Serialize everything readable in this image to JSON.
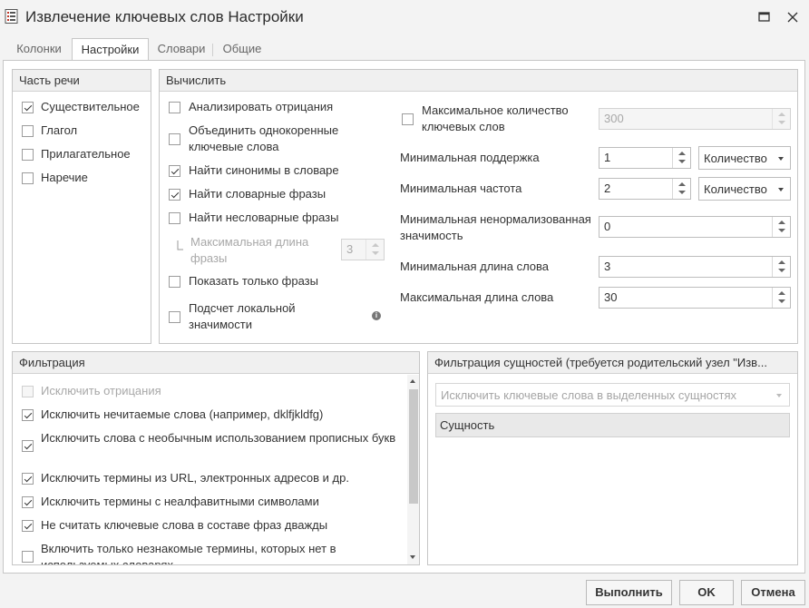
{
  "window": {
    "title": "Извлечение ключевых слов Настройки",
    "icons": [
      "app-settings-icon",
      "maximize-icon",
      "close-icon"
    ]
  },
  "tabs": [
    {
      "label": "Колонки",
      "active": false
    },
    {
      "label": "Настройки",
      "active": true
    },
    {
      "label": "Словари",
      "active": false
    },
    {
      "label": "Общие",
      "active": false
    }
  ],
  "pos_panel": {
    "title": "Часть речи",
    "items": [
      {
        "label": "Существительное",
        "checked": true
      },
      {
        "label": "Глагол",
        "checked": false
      },
      {
        "label": "Прилагательное",
        "checked": false
      },
      {
        "label": "Наречие",
        "checked": false
      }
    ]
  },
  "compute_panel": {
    "title": "Вычислить",
    "options": {
      "analyze_negations": {
        "label": "Анализировать отрицания",
        "checked": false
      },
      "merge_cognates": {
        "label": "Объединить однокоренные ключевые слова",
        "checked": false
      },
      "find_synonyms": {
        "label": "Найти синонимы в словаре",
        "checked": true
      },
      "find_dict_phrases": {
        "label": "Найти словарные фразы",
        "checked": true
      },
      "find_nondict_phrases": {
        "label": "Найти несловарные фразы",
        "checked": false
      },
      "max_phrase_length": {
        "label": "Максимальная длина фразы",
        "value": "3"
      },
      "show_only_phrases": {
        "label": "Показать только фразы",
        "checked": false
      },
      "local_significance": {
        "label": "Подсчет локальной значимости",
        "checked": false
      }
    },
    "max_keywords": {
      "label": "Максимальное количество ключевых слов",
      "value": "300",
      "checked": false
    },
    "min_support": {
      "label": "Минимальная поддержка",
      "value": "1",
      "unit": "Количество"
    },
    "min_frequency": {
      "label": "Минимальная частота",
      "value": "2",
      "unit": "Количество"
    },
    "min_unnormalized": {
      "label": "Минимальная ненормализованная значимость",
      "value": "0"
    },
    "min_word_length": {
      "label": "Минимальная длина слова",
      "value": "3"
    },
    "max_word_length": {
      "label": "Максимальная длина слова",
      "value": "30"
    }
  },
  "filter_panel": {
    "title": "Фильтрация",
    "items": [
      {
        "label": "Исключить отрицания",
        "checked": false,
        "disabled": true
      },
      {
        "label": "Исключить нечитаемые слова (например, dklfjkldfg)",
        "checked": true
      },
      {
        "label": "Исключить слова с необычным использованием прописных букв",
        "checked": true
      },
      {
        "label": "Исключить термины из URL, электронных адресов и др.",
        "checked": true
      },
      {
        "label": "Исключить термины с неалфавитными символами",
        "checked": true
      },
      {
        "label": "Не считать ключевые слова в составе фраз дважды",
        "checked": true
      },
      {
        "label": "Включить только незнакомые термины, которых нет в используемых словарях",
        "checked": false
      }
    ]
  },
  "entity_panel": {
    "title": "Фильтрация сущностей (требуется родительский узел \"Изв...",
    "select_value": "Исключить ключевые слова в выделенных сущностях",
    "column_header": "Сущность"
  },
  "footer": {
    "run": "Выполнить",
    "ok": "OK",
    "cancel": "Отмена"
  }
}
